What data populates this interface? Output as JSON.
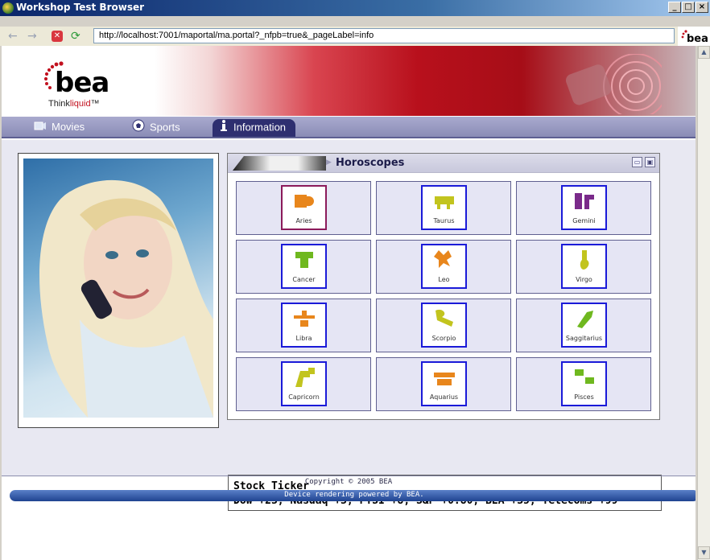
{
  "window": {
    "title": "Workshop Test Browser"
  },
  "toolbar": {
    "back_glyph": "←",
    "forward_glyph": "→",
    "stop_glyph": "✕",
    "refresh_glyph": "⟳",
    "url": "http://localhost:7001/maportal/ma.portal?_nfpb=true&_pageLabel=info"
  },
  "header": {
    "logo_text": "bea",
    "tagline_prefix": "Think",
    "tagline_liquid": "liquid",
    "tagline_tm": "™"
  },
  "tabs": [
    {
      "label": "Movies",
      "icon": "camera-icon"
    },
    {
      "label": "Sports",
      "icon": "soccer-ball-icon"
    },
    {
      "label": "Information",
      "icon": "info-icon",
      "active": true
    }
  ],
  "horoscopes": {
    "title": "Horoscopes",
    "signs": [
      {
        "label": "Aries",
        "color": "#e8861c",
        "selected": true
      },
      {
        "label": "Taurus",
        "color": "#c2c41e"
      },
      {
        "label": "Gemini",
        "color": "#7a2a8a"
      },
      {
        "label": "Cancer",
        "color": "#6fb81f"
      },
      {
        "label": "Leo",
        "color": "#e8861c"
      },
      {
        "label": "Virgo",
        "color": "#c2c41e"
      },
      {
        "label": "Libra",
        "color": "#e8861c"
      },
      {
        "label": "Scorpio",
        "color": "#c2c41e"
      },
      {
        "label": "Saggitarius",
        "color": "#6fb81f"
      },
      {
        "label": "Capricorn",
        "color": "#c2c41e"
      },
      {
        "label": "Aquarius",
        "color": "#e8861c"
      },
      {
        "label": "Pisces",
        "color": "#6fb81f"
      }
    ]
  },
  "ticker": {
    "title": "Stock Ticker",
    "text": "Dow +23, Nasdaq +3, FTSI +8, S&P +0.80, BEA +35, Telecoms +99"
  },
  "footer": {
    "copyright": "Copyright © 2005 BEA",
    "powered": "Device rendering powered by BEA."
  },
  "colors": {
    "tab_bar": "#8a8cb6",
    "active_tab": "#2e2f70",
    "accent_red": "#c2111f"
  }
}
